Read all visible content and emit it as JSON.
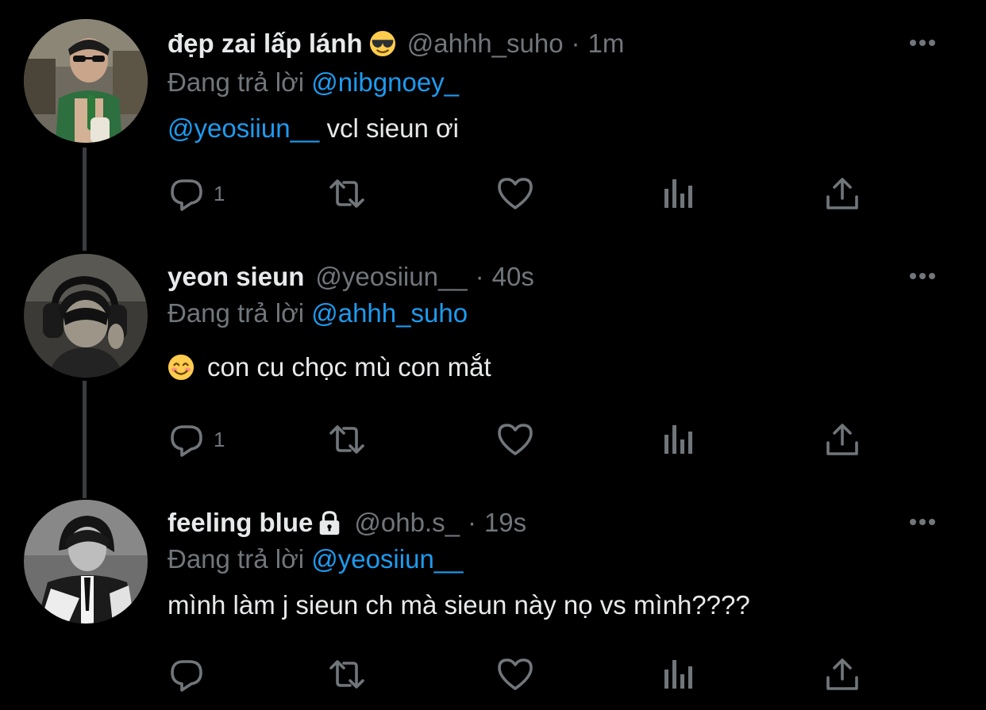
{
  "colors": {
    "background": "#000000",
    "primary_text": "#e7e9ea",
    "secondary_text": "#71767b",
    "link": "#1d9bf0",
    "thread_line": "#3a3d40"
  },
  "tweets": [
    {
      "display_name": "đẹp zai lấp lánh",
      "name_badge": "sunglasses-emoji",
      "handle": "@ahhh_suho",
      "separator": "·",
      "time": "1m",
      "reply_prefix": "Đang trả lời",
      "reply_to": "@nibgnoey_",
      "body_mention": "@yeosiiun__",
      "body_text": " vcl sieun ơi",
      "reply_count": "1",
      "icons": [
        "reply-icon",
        "retweet-icon",
        "like-icon",
        "views-icon",
        "share-icon"
      ]
    },
    {
      "display_name": "yeon sieun",
      "handle": "@yeosiiun__",
      "separator": "·",
      "time": "40s",
      "reply_prefix": "Đang trả lời",
      "reply_to": "@ahhh_suho",
      "body_emoji": "smiling-face-emoji",
      "body_text": "con cu chọc mù con mắt",
      "reply_count": "1",
      "icons": [
        "reply-icon",
        "retweet-icon",
        "like-icon",
        "views-icon",
        "share-icon"
      ]
    },
    {
      "display_name": "feeling blue",
      "name_badge": "lock-icon",
      "handle": "@ohb.s_",
      "separator": "·",
      "time": "19s",
      "reply_prefix": "Đang trả lời",
      "reply_to": "@yeosiiun__",
      "body_text": "mình làm j sieun ch mà sieun này nọ vs mình????",
      "reply_count": "",
      "icons": [
        "reply-icon",
        "retweet-icon",
        "like-icon",
        "views-icon",
        "share-icon"
      ]
    }
  ]
}
